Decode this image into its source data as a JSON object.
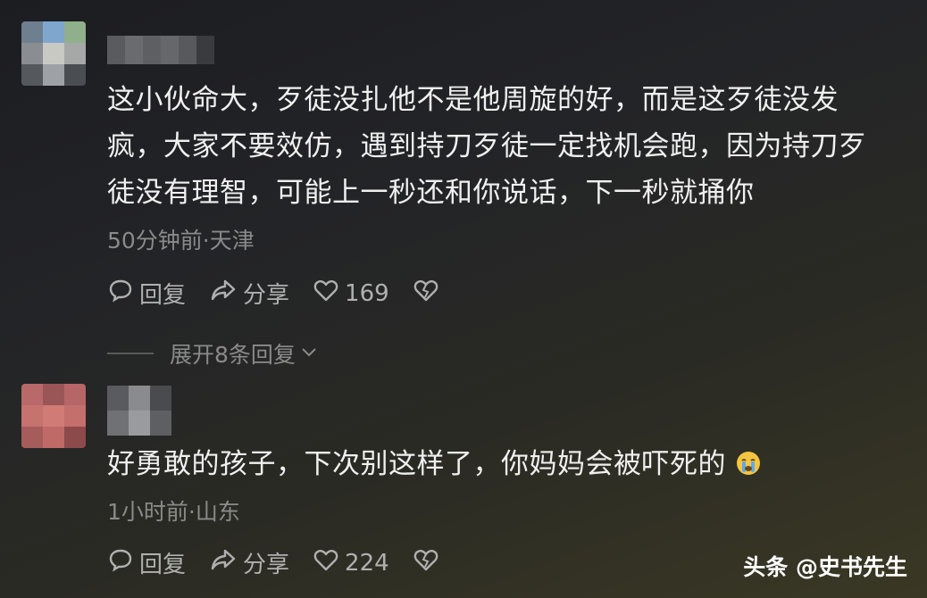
{
  "comments": [
    {
      "text": "这小伙命大，歹徒没扎他不是他周旋的好，而是这歹徒没发疯，大家不要效仿，遇到持刀歹徒一定找机会跑，因为持刀歹徒没有理智，可能上一秒还和你说话，下一秒就捅你",
      "meta": "50分钟前·天津",
      "reply_label": "回复",
      "share_label": "分享",
      "likes": "169"
    },
    {
      "text": "好勇敢的孩子，下次别这样了，你妈妈会被吓死的",
      "emoji": "crying-face",
      "meta": "1小时前·山东",
      "reply_label": "回复",
      "share_label": "分享",
      "likes": "224"
    }
  ],
  "expand_replies_label": "展开8条回复",
  "watermark": "头条 @史书先生",
  "colors": {
    "meta_text": "#8a8a8a",
    "action_text": "#b0b0b0",
    "body_text": "#f0f0f0"
  }
}
